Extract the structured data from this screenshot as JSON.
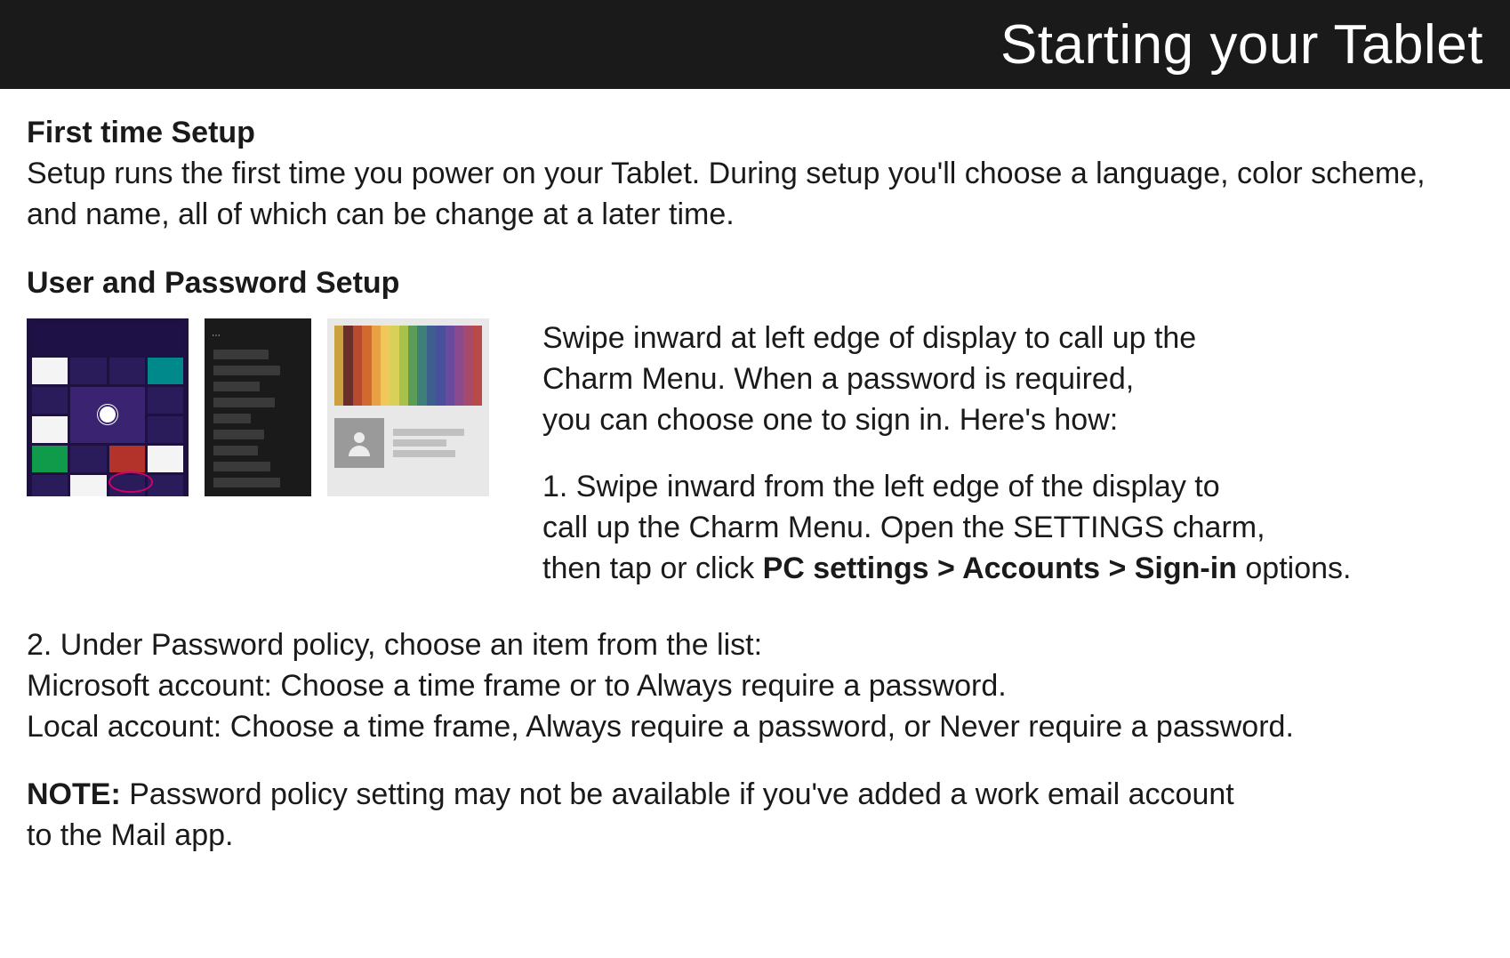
{
  "header": {
    "title": "Starting your Tablet"
  },
  "section1": {
    "heading": "First time Setup",
    "body": "Setup runs the first time you power on your Tablet. During setup you'll choose a language, color scheme, and name, all of which can be change at a later time."
  },
  "section2": {
    "heading": "User and Password Setup",
    "intro1": "Swipe inward at left edge of display to call up the",
    "intro2": "Charm Menu. When a password is required,",
    "intro3": "you can choose one to sign in. Here's how:",
    "step1_l1": "1. Swipe inward from the left edge of the display to",
    "step1_l2": "call up the Charm Menu. Open the SETTINGS charm,",
    "step1_l3a": "then tap or click ",
    "step1_bold": "PC settings > Accounts > Sign-in",
    "step1_l3b": " options."
  },
  "section3": {
    "step2_l1": "2. Under Password policy, choose an item from the list:",
    "step2_l2": "Microsoft account: Choose a time frame or to Always require a password.",
    "step2_l3": "Local account: Choose a time frame, Always require a password, or Never require a password.",
    "note_label": "NOTE:",
    "note_l1": " Password policy setting may not be available if you've added a work email account",
    "note_l2": "to the Mail app."
  },
  "swatch_colors": [
    "#caa23d",
    "#6b2f2a",
    "#b84a30",
    "#d06a2e",
    "#e8a042",
    "#f0c85a",
    "#d9d05a",
    "#a7c14a",
    "#5b9c57",
    "#3f7f79",
    "#3c5f8d",
    "#4a4f9c",
    "#6a4a9c",
    "#8a4a8d",
    "#a84a6b",
    "#b84a4a"
  ]
}
